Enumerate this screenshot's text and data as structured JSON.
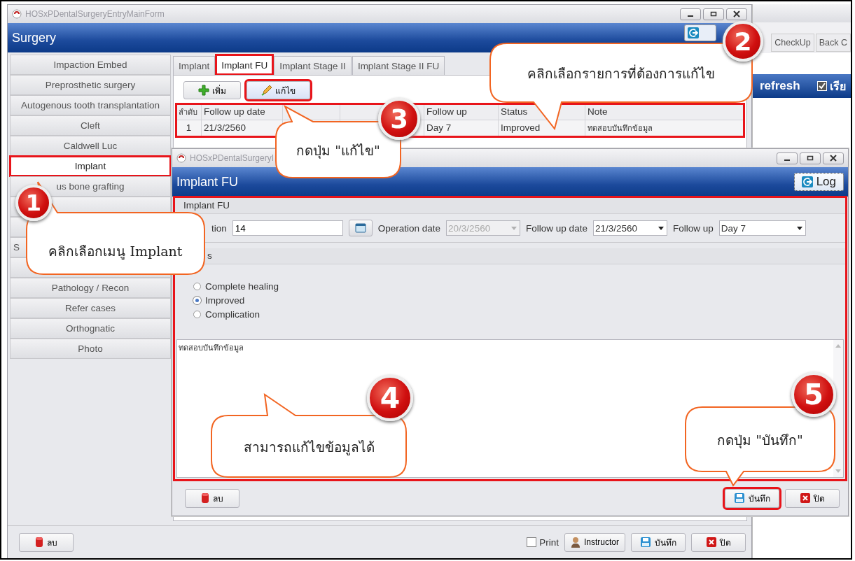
{
  "main_window": {
    "title": "HOSxPDentalSurgeryEntryMainForm",
    "header": "Surgery",
    "sidebar": {
      "items": [
        {
          "kind": "button",
          "label": "Impaction Embed",
          "selected": false,
          "highlighted": false
        },
        {
          "kind": "button",
          "label": "Preprosthetic surgery",
          "selected": false,
          "highlighted": false
        },
        {
          "kind": "button",
          "label": "Autogenous tooth transplantation",
          "selected": false,
          "highlighted": false
        },
        {
          "kind": "button",
          "label": "Cleft",
          "selected": false,
          "highlighted": false
        },
        {
          "kind": "button",
          "label": "Caldwell Luc",
          "selected": false,
          "highlighted": false
        },
        {
          "kind": "button",
          "label": "Implant",
          "selected": true,
          "highlighted": true
        },
        {
          "kind": "button",
          "label": "us bone grafting",
          "selected": false,
          "highlighted": false
        },
        {
          "kind": "button",
          "selected": false,
          "highlighted": false
        },
        {
          "kind": "button",
          "selected": false,
          "highlighted": false
        },
        {
          "kind": "cut",
          "label": "S",
          "selected": false,
          "highlighted": false
        },
        {
          "kind": "button",
          "selected": false,
          "highlighted": false
        },
        {
          "kind": "button",
          "label": "Pathology / Recon",
          "selected": false,
          "highlighted": false
        },
        {
          "kind": "button",
          "label": "Refer cases",
          "selected": false,
          "highlighted": false
        },
        {
          "kind": "button",
          "label": "Orthognatic",
          "selected": false,
          "highlighted": false
        },
        {
          "kind": "button",
          "label": "Photo",
          "selected": false,
          "highlighted": false
        }
      ]
    },
    "tabs": [
      {
        "label": "Implant",
        "selected": false,
        "highlighted": false
      },
      {
        "label": "Implant FU",
        "selected": true,
        "highlighted": true
      },
      {
        "label": "Implant Stage II",
        "selected": false,
        "highlighted": false
      },
      {
        "label": "Implant Stage II FU",
        "selected": false,
        "highlighted": false
      }
    ],
    "toolbar": [
      {
        "kind": "add",
        "label": "เพิ่ม",
        "highlighted": false
      },
      {
        "kind": "edit",
        "label": "แก้ไข",
        "highlighted": true
      }
    ],
    "table": {
      "highlighted": true,
      "columns": [
        {
          "label": "ลำดับ"
        },
        {
          "label": "Follow up date"
        },
        {},
        {},
        {
          "label": "Follow up"
        },
        {
          "label": "Status"
        },
        {
          "label": "Note"
        }
      ],
      "rows": [
        {
          "cells": [
            "1",
            "21/3/2560",
            null,
            null,
            "Day 7",
            "Improved",
            "ทดสอบบันทึกข้อมูล"
          ]
        }
      ]
    },
    "footer": {
      "left_buttons": [
        {
          "kind": "delete",
          "label": "ลบ"
        }
      ],
      "print": {
        "label": "Print",
        "checked": false
      },
      "right_buttons": [
        {
          "kind": "instructor",
          "label": "Instructor"
        },
        {
          "kind": "save",
          "label": "บันทึก"
        },
        {
          "kind": "close",
          "label": "ปิด"
        }
      ]
    }
  },
  "side_window": {
    "tabs": [
      "CheckUp",
      "Back C"
    ],
    "toolbar_label": "refresh",
    "checkbox": {
      "label": "เรีย",
      "checked": true
    }
  },
  "dialog": {
    "title": "HOSxPDentalSurgeryI",
    "header": "Implant FU",
    "log_button": "Log",
    "form": {
      "highlighted": true,
      "group_title": "Implant FU",
      "fields": [
        {
          "kind": "text",
          "label": "tion",
          "value": "14"
        },
        {
          "kind": "calendar"
        },
        {
          "kind": "combo",
          "label": "Operation date",
          "value": "20/3/2560",
          "disabled": true
        },
        {
          "kind": "combo",
          "label": "Follow up date",
          "value": "21/3/2560",
          "disabled": false
        },
        {
          "kind": "combo",
          "label": "Follow up",
          "value": "Day 7",
          "disabled": false
        }
      ],
      "section_title": "s",
      "options": [
        {
          "label": "Complete healing",
          "selected": false
        },
        {
          "label": "Improved",
          "selected": true
        },
        {
          "label": "Complication",
          "selected": false
        }
      ],
      "note": "ทดสอบบันทึกข้อมูล"
    },
    "left_buttons": [
      {
        "kind": "delete",
        "label": "ลบ",
        "highlighted": false
      }
    ],
    "right_buttons": [
      {
        "kind": "save",
        "label": "บันทึก",
        "highlighted": true
      },
      {
        "kind": "close",
        "label": "ปิด",
        "highlighted": false
      }
    ]
  },
  "callouts": [
    {
      "number": "1",
      "text": "คลิกเลือกเมนู Implant"
    },
    {
      "number": "2",
      "text": "คลิกเลือกรายการที่ต้องการแก้ไข"
    },
    {
      "number": "3",
      "text": "กดปุ่ม \"แก้ไข\""
    },
    {
      "number": "4",
      "text": "สามารถแก้ไขข้อมูลได้"
    },
    {
      "number": "5",
      "text": "กดปุ่ม \"บันทึก\""
    }
  ]
}
